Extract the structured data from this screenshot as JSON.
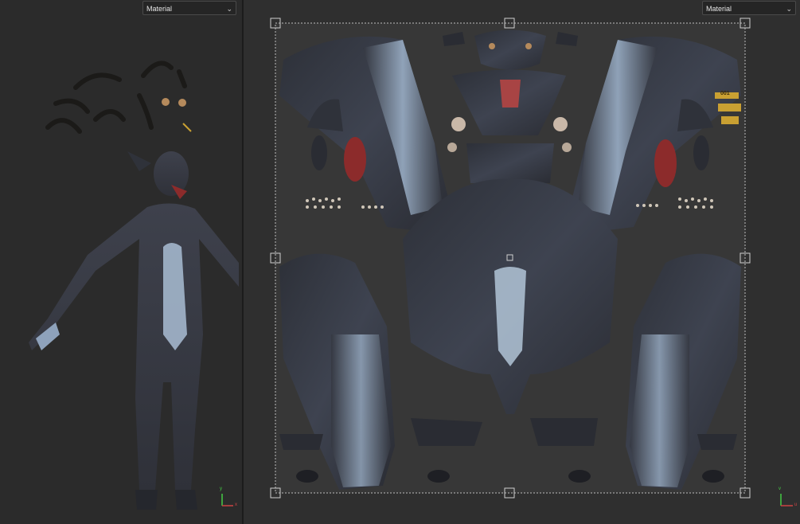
{
  "viewport3d": {
    "material_select": {
      "value": "Material"
    },
    "axis_labels": {
      "x": "x",
      "y": "y"
    }
  },
  "uv_editor": {
    "material_select": {
      "value": "Material"
    },
    "island_label": "001",
    "axis_labels": {
      "x": "u",
      "y": "v"
    }
  },
  "colors": {
    "panel_bg": "#2b2b2b",
    "uv_bg": "#2f2f2f",
    "fur": "#3a3d48",
    "fur_light": "#a9bdd4",
    "tongue": "#8c2b2b",
    "label_gold": "#c9a032"
  }
}
